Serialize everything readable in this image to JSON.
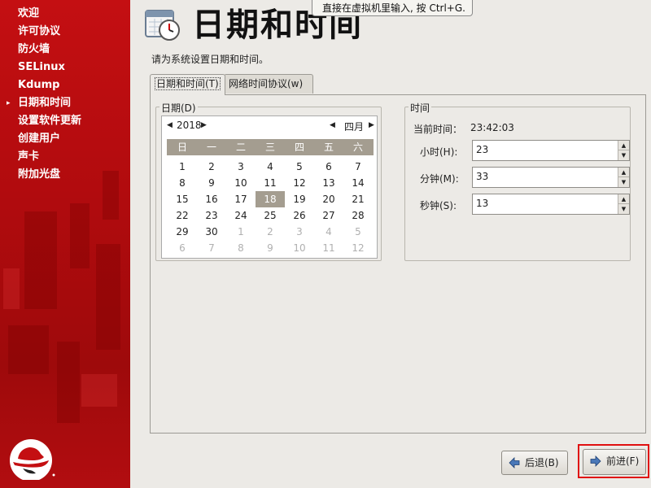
{
  "sidebar": {
    "items": [
      {
        "label": "欢迎",
        "active": false
      },
      {
        "label": "许可协议",
        "active": false
      },
      {
        "label": "防火墙",
        "active": false
      },
      {
        "label": "SELinux",
        "active": false
      },
      {
        "label": "Kdump",
        "active": false
      },
      {
        "label": "日期和时间",
        "active": true
      },
      {
        "label": "设置软件更新",
        "active": false
      },
      {
        "label": "创建用户",
        "active": false
      },
      {
        "label": "声卡",
        "active": false
      },
      {
        "label": "附加光盘",
        "active": false
      }
    ],
    "active_marker": "▸",
    "logo_icon": "redhat-shadowman-logo-icon"
  },
  "header": {
    "title": "日期和时间",
    "icon": "calendar-clock-icon",
    "tooltip": "直接在虚拟机里输入, 按 Ctrl+G."
  },
  "instructions": "请为系统设置日期和时间。",
  "tabs": [
    {
      "label": "日期和时间(T)",
      "selected": true
    },
    {
      "label": "网络时间协议(w)",
      "selected": false
    }
  ],
  "date": {
    "frame_label": "日期(D)",
    "year": "2018",
    "month": "四月",
    "weekdays": [
      "日",
      "一",
      "二",
      "三",
      "四",
      "五",
      "六"
    ],
    "weeks": [
      [
        {
          "d": "1",
          "o": false
        },
        {
          "d": "2",
          "o": false
        },
        {
          "d": "3",
          "o": false
        },
        {
          "d": "4",
          "o": false
        },
        {
          "d": "5",
          "o": false
        },
        {
          "d": "6",
          "o": false
        },
        {
          "d": "7",
          "o": false
        }
      ],
      [
        {
          "d": "8",
          "o": false
        },
        {
          "d": "9",
          "o": false
        },
        {
          "d": "10",
          "o": false
        },
        {
          "d": "11",
          "o": false
        },
        {
          "d": "12",
          "o": false
        },
        {
          "d": "13",
          "o": false
        },
        {
          "d": "14",
          "o": false
        }
      ],
      [
        {
          "d": "15",
          "o": false
        },
        {
          "d": "16",
          "o": false
        },
        {
          "d": "17",
          "o": false
        },
        {
          "d": "18",
          "o": false,
          "sel": true
        },
        {
          "d": "19",
          "o": false
        },
        {
          "d": "20",
          "o": false
        },
        {
          "d": "21",
          "o": false
        }
      ],
      [
        {
          "d": "22",
          "o": false
        },
        {
          "d": "23",
          "o": false
        },
        {
          "d": "24",
          "o": false
        },
        {
          "d": "25",
          "o": false
        },
        {
          "d": "26",
          "o": false
        },
        {
          "d": "27",
          "o": false
        },
        {
          "d": "28",
          "o": false
        }
      ],
      [
        {
          "d": "29",
          "o": false
        },
        {
          "d": "30",
          "o": false
        },
        {
          "d": "1",
          "o": true
        },
        {
          "d": "2",
          "o": true
        },
        {
          "d": "3",
          "o": true
        },
        {
          "d": "4",
          "o": true
        },
        {
          "d": "5",
          "o": true
        }
      ],
      [
        {
          "d": "6",
          "o": true
        },
        {
          "d": "7",
          "o": true
        },
        {
          "d": "8",
          "o": true
        },
        {
          "d": "9",
          "o": true
        },
        {
          "d": "10",
          "o": true
        },
        {
          "d": "11",
          "o": true
        },
        {
          "d": "12",
          "o": true
        }
      ]
    ],
    "selected_day": "18"
  },
  "time": {
    "frame_label": "时间",
    "current_label": "当前时间：",
    "current_value": "23:42:03",
    "hour_label": "小时(H):",
    "hour": "23",
    "minute_label": "分钟(M):",
    "minute": "33",
    "second_label": "秒钟(S):",
    "second": "13"
  },
  "buttons": {
    "back": "后退(B)",
    "next": "前进(F)"
  },
  "colors": {
    "sidebar_red": "#c40f12",
    "highlight_red": "#e01010",
    "calendar_header": "#a49d90"
  }
}
